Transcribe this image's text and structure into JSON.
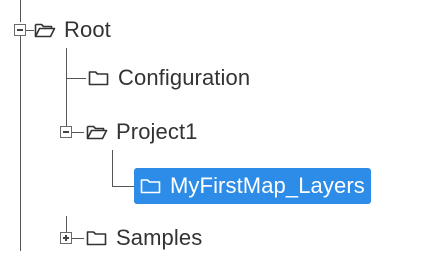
{
  "tree": {
    "root": {
      "label": "Root",
      "icon": "folder-open-icon",
      "expanded": true
    },
    "children": [
      {
        "label": "Configuration",
        "icon": "folder-icon",
        "expanded": null
      },
      {
        "label": "Project1",
        "icon": "folder-open-icon",
        "expanded": true,
        "children": [
          {
            "label": "MyFirstMap_Layers",
            "icon": "folder-icon",
            "selected": true
          }
        ]
      },
      {
        "label": "Samples",
        "icon": "folder-icon",
        "expanded": false
      }
    ]
  },
  "colors": {
    "selection": "#2d8ce8",
    "text": "#333333"
  }
}
